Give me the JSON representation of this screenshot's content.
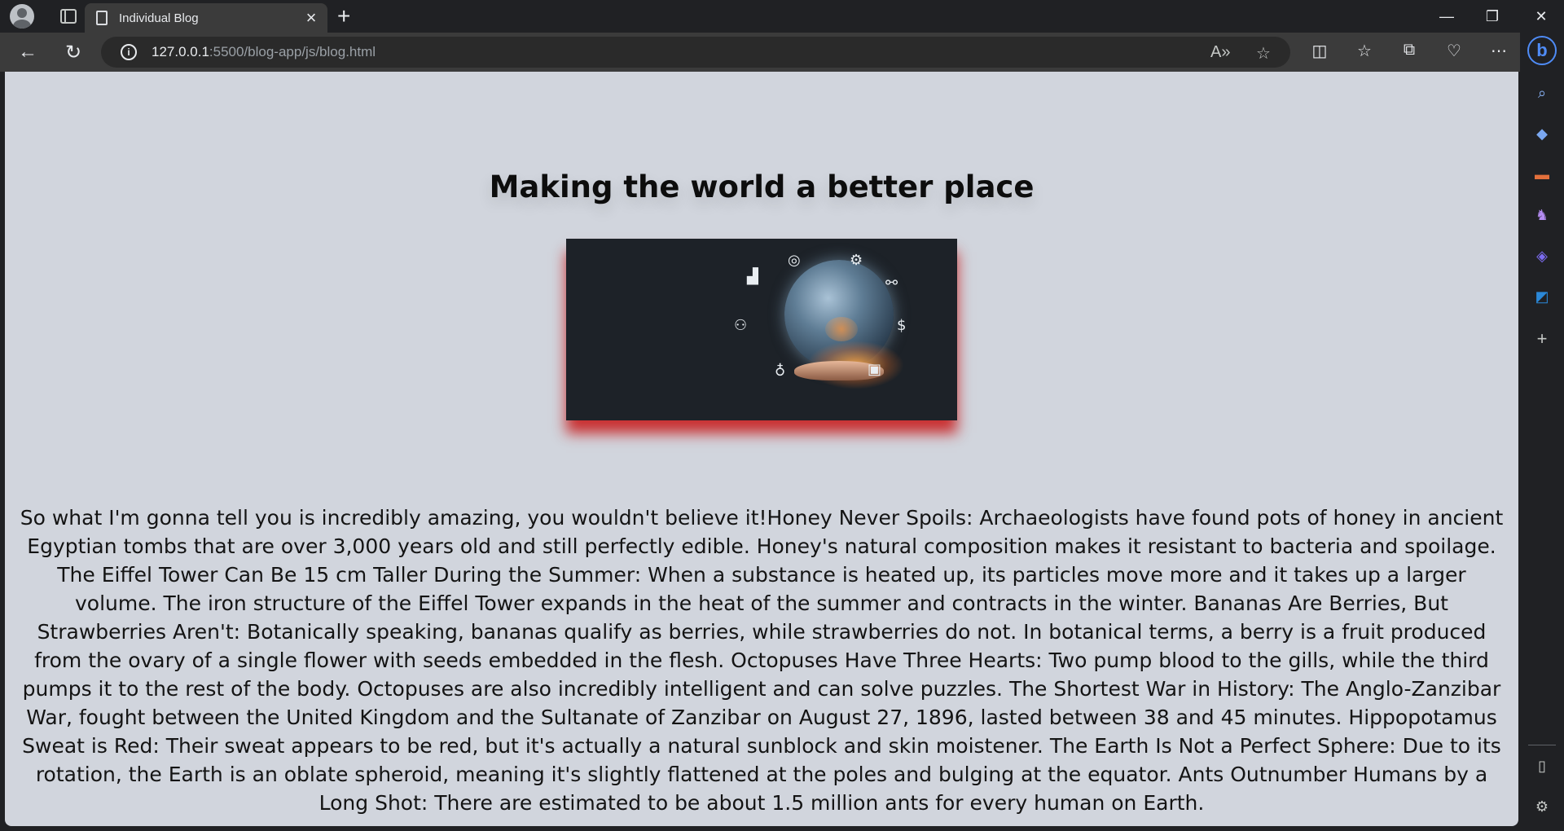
{
  "browser": {
    "tab_title": "Individual Blog",
    "tab_close": "×",
    "new_tab": "+",
    "url_host": "127.0.0.1",
    "url_path": ":5500/blog-app/js/blog.html",
    "window_controls": {
      "minimize": "—",
      "restore": "❐",
      "close": "✕"
    },
    "toolbar_icons": [
      "read-aloud-icon",
      "favorite-star-icon",
      "split-screen-icon",
      "favorites-icon",
      "collections-icon",
      "browser-essentials-icon",
      "more-icon"
    ],
    "sidebar_icons": [
      "bing-copilot-icon",
      "search-icon",
      "shopping-tag-icon",
      "tools-briefcase-icon",
      "games-icon",
      "microsoft-365-icon",
      "outlook-icon",
      "add-icon",
      "hide-sidebar-icon",
      "settings-icon"
    ]
  },
  "blog": {
    "title": "Making the world a better place",
    "body": "So what I'm gonna tell you is incredibly amazing, you wouldn't believe it!Honey Never Spoils: Archaeologists have found pots of honey in ancient Egyptian tombs that are over 3,000 years old and still perfectly edible. Honey's natural composition makes it resistant to bacteria and spoilage. The Eiffel Tower Can Be 15 cm Taller During the Summer: When a substance is heated up, its particles move more and it takes up a larger volume. The iron structure of the Eiffel Tower expands in the heat of the summer and contracts in the winter. Bananas Are Berries, But Strawberries Aren't: Botanically speaking, bananas qualify as berries, while strawberries do not. In botanical terms, a berry is a fruit produced from the ovary of a single flower with seeds embedded in the flesh. Octopuses Have Three Hearts: Two pump blood to the gills, while the third pumps it to the rest of the body. Octopuses are also incredibly intelligent and can solve puzzles. The Shortest War in History: The Anglo-Zanzibar War, fought between the United Kingdom and the Sultanate of Zanzibar on August 27, 1896, lasted between 38 and 45 minutes. Hippopotamus Sweat is Red: Their sweat appears to be red, but it's actually a natural sunblock and skin moistener. The Earth Is Not a Perfect Sphere: Due to its rotation, the Earth is an oblate spheroid, meaning it's slightly flattened at the poles and bulging at the equator. Ants Outnumber Humans by a Long Shot: There are estimated to be about 1.5 million ants for every human on Earth."
  },
  "colors": {
    "page_background": "#d1d5dd",
    "image_shadow": "#c81414",
    "chrome_dark": "#202124",
    "toolbar": "#3b3b3b"
  }
}
